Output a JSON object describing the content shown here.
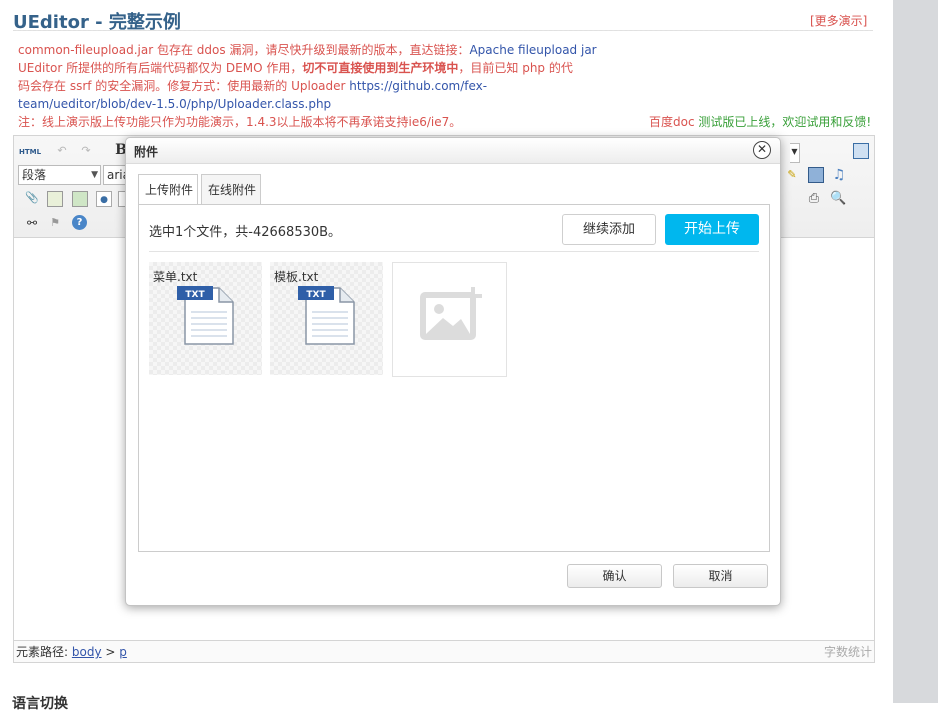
{
  "page": {
    "title": "UEditor - 完整示例",
    "more_demo": "[更多演示]"
  },
  "notice": {
    "line1_prefix": "common-fileupload.jar 包存在 ddos 漏洞，请尽快升级到最新的版本，直达链接：",
    "line1_link": "Apache fileupload jar",
    "line2_prefix": "UEditor 所提供的所有后端代码都仅为 DEMO 作用，",
    "line2_bold": "切不可直接使用到生产环境中",
    "line2_suffix": "，目前已知 php 的代",
    "line3_prefix": "码会存在 ssrf 的安全漏洞。修复方式：使用最新的 Uploader ",
    "line3_link": "https://github.com/fex-",
    "line4_link": "team/ueditor/blob/dev-1.5.0/php/Uploader.class.php",
    "line5": "注：线上演示版上传功能只作为功能演示，1.4.3以上版本将不再承诺支持ie6/ie7。",
    "right_prefix": "百度doc ",
    "right_green": "测试版已上线，欢迎试用和反馈!"
  },
  "toolbar": {
    "html_label": "HTML",
    "bold_label": "B",
    "paragraph_select": "段落",
    "font_select": "aria"
  },
  "statusbar": {
    "path_label": "元素路径:",
    "path_body": "body",
    "path_sep": " > ",
    "path_p": "p",
    "word_count": "字数统计"
  },
  "dialog": {
    "title": "附件",
    "close_glyph": "✕",
    "tabs": [
      {
        "label": "上传附件",
        "active": true
      },
      {
        "label": "在线附件",
        "active": false
      }
    ],
    "status_text": "选中1个文件，共-42668530B。",
    "add_button": "继续添加",
    "upload_button": "开始上传",
    "files": [
      {
        "name": "菜单.txt",
        "icon_label": "TXT"
      },
      {
        "name": "模板.txt",
        "icon_label": "TXT"
      }
    ],
    "confirm_button": "确认",
    "cancel_button": "取消"
  },
  "bottom": {
    "partial_heading": "语言切换"
  },
  "colors": {
    "accent": "#00b7ee",
    "title": "#35628a",
    "warning": "#d9534f",
    "link": "#3355aa"
  }
}
